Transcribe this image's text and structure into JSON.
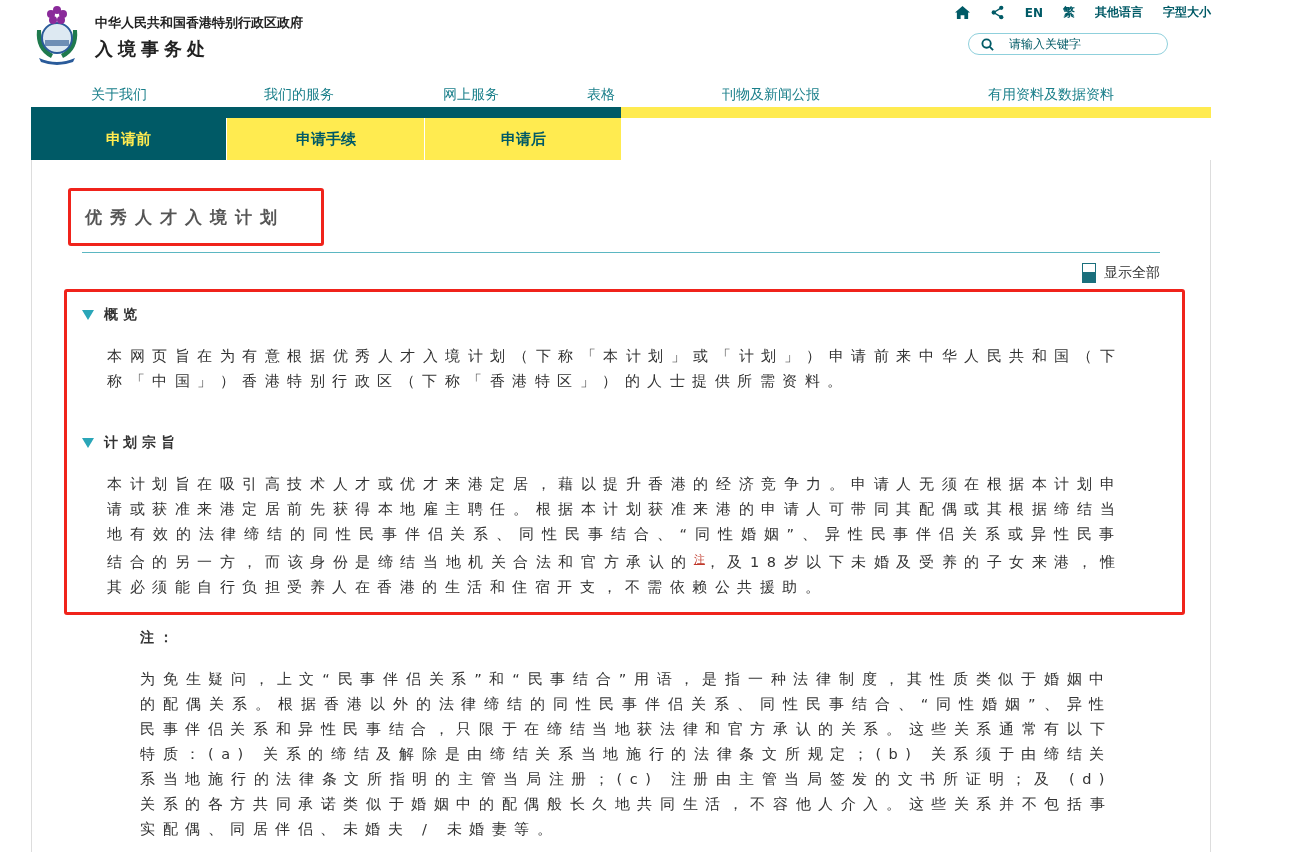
{
  "header": {
    "government": "中华人民共和国香港特别行政区政府",
    "department": "入境事务处"
  },
  "utility_links": [
    {
      "kind": "home"
    },
    {
      "kind": "share"
    },
    {
      "kind": "text",
      "label": "EN"
    },
    {
      "kind": "text",
      "label": "繁"
    },
    {
      "kind": "text",
      "label": "其他语言"
    },
    {
      "kind": "text",
      "label": "字型大小"
    }
  ],
  "search": {
    "placeholder": "请输入关键字"
  },
  "main_nav": [
    "关于我们",
    "我们的服务",
    "网上服务",
    "表格",
    "刊物及新闻公报",
    "有用资料及数据资料"
  ],
  "sub_tabs": [
    {
      "label": "申请前",
      "selected": true
    },
    {
      "label": "申请手续",
      "selected": false
    },
    {
      "label": "申请后",
      "selected": false
    }
  ],
  "page_title": {
    "text": "优秀人才入境计划",
    "highlighted": true
  },
  "show_all": "显示全部",
  "sections_highlighted": true,
  "sections": [
    {
      "heading": "概览",
      "expanded": true,
      "body": [
        {
          "kind": "text",
          "text": "本网页旨在为有意根据优秀人才入境计划（下称「本计划」或「计划」）申请前来中华人民共和国（下称「中国」）香港特别行政区（下称「香港特区」）的人士提供所需资料。"
        }
      ]
    },
    {
      "heading": "计划宗旨",
      "expanded": true,
      "body": [
        {
          "kind": "text",
          "text": "本计划旨在吸引高技术人才或优才来港定居，藉以提升香港的经济竞争力。申请人无须在根据本计划申请或获准来港定居前先获得本地雇主聘任。根据本计划获准来港的申请人可带同其配偶或其根据缔结当地有效的法律缔结的同性民事伴侣关系、同性民事结合、“同性婚姻”、异性民事伴侣关系或异性民事结合的另一方，而该身份是缔结当地机关合法和官方承认的"
        },
        {
          "kind": "link",
          "text": "注"
        },
        {
          "kind": "text",
          "text": "，及18岁以下未婚及受养的子女来港，惟其必须能自行负担受养人在香港的生活和住宿开支，不需依赖公共援助。"
        }
      ]
    }
  ],
  "note": {
    "label": "注：",
    "text": "为免生疑问，上文“民事伴侣关系”和“民事结合”用语，是指一种法律制度，其性质类似于婚姻中的配偶关系。根据香港以外的法律缔结的同性民事伴侣关系、同性民事结合、“同性婚姻”、异性民事伴侣关系和异性民事结合，只限于在缔结当地获法律和官方承认的关系。这些关系通常有以下特质：(a) 关系的缔结及解除是由缔结关系当地施行的法律条文所规定；(b) 关系须于由缔结关系当地施行的法律条文所指明的主管当局注册；(c) 注册由主管当局签发的文书所证明；及 (d) 关系的各方共同承诺类似于婚姻中的配偶般长久地共同生活，不容他人介入。这些关系并不包括事实配偶、同居伴侣、未婚夫 / 未婚妻等。"
  }
}
